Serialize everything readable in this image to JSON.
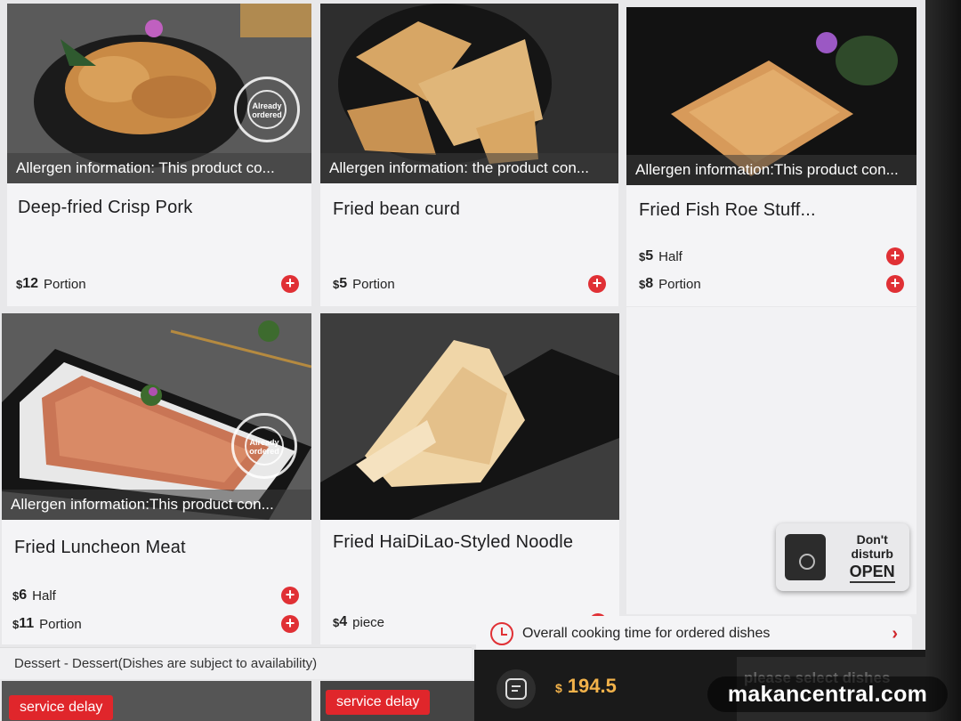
{
  "cards": [
    {
      "allergen": "Allergen information: This product co...",
      "name": "Deep-fried Crisp Pork",
      "stamp": "Already ordered",
      "prices": [
        {
          "currency": "$",
          "amount": "12",
          "unit": "Portion"
        }
      ]
    },
    {
      "allergen": "Allergen information: the product con...",
      "name": "Fried bean curd",
      "prices": [
        {
          "currency": "$",
          "amount": "5",
          "unit": "Portion"
        }
      ]
    },
    {
      "allergen": "Allergen information:This product con...",
      "name": "Fried Fish Roe Stuff...",
      "prices": [
        {
          "currency": "$",
          "amount": "5",
          "unit": "Half"
        },
        {
          "currency": "$",
          "amount": "8",
          "unit": "Portion"
        }
      ]
    },
    {
      "allergen": "Allergen information:This product con...",
      "name": "Fried Luncheon Meat",
      "stamp": "Already ordered",
      "prices": [
        {
          "currency": "$",
          "amount": "6",
          "unit": "Half"
        },
        {
          "currency": "$",
          "amount": "11",
          "unit": "Portion"
        }
      ]
    },
    {
      "name": "Fried HaiDiLao-Styled Noodle",
      "prices": [
        {
          "currency": "$",
          "amount": "4",
          "unit": "piece"
        }
      ]
    }
  ],
  "section_label": "Dessert - Dessert(Dishes are subject to availability)",
  "service_delay": "service delay",
  "cooking_time": "Overall cooking time for ordered dishes",
  "chevron": "›",
  "total": {
    "currency": "$",
    "amount": "194.5"
  },
  "select_dishes": "please select dishes",
  "dnd": {
    "line1": "Don't disturb",
    "line2": "OPEN"
  },
  "add_symbol": "+",
  "watermark": "makancentral.com",
  "colors": {
    "accent_red": "#e03035",
    "total_gold": "#f2b24a"
  }
}
